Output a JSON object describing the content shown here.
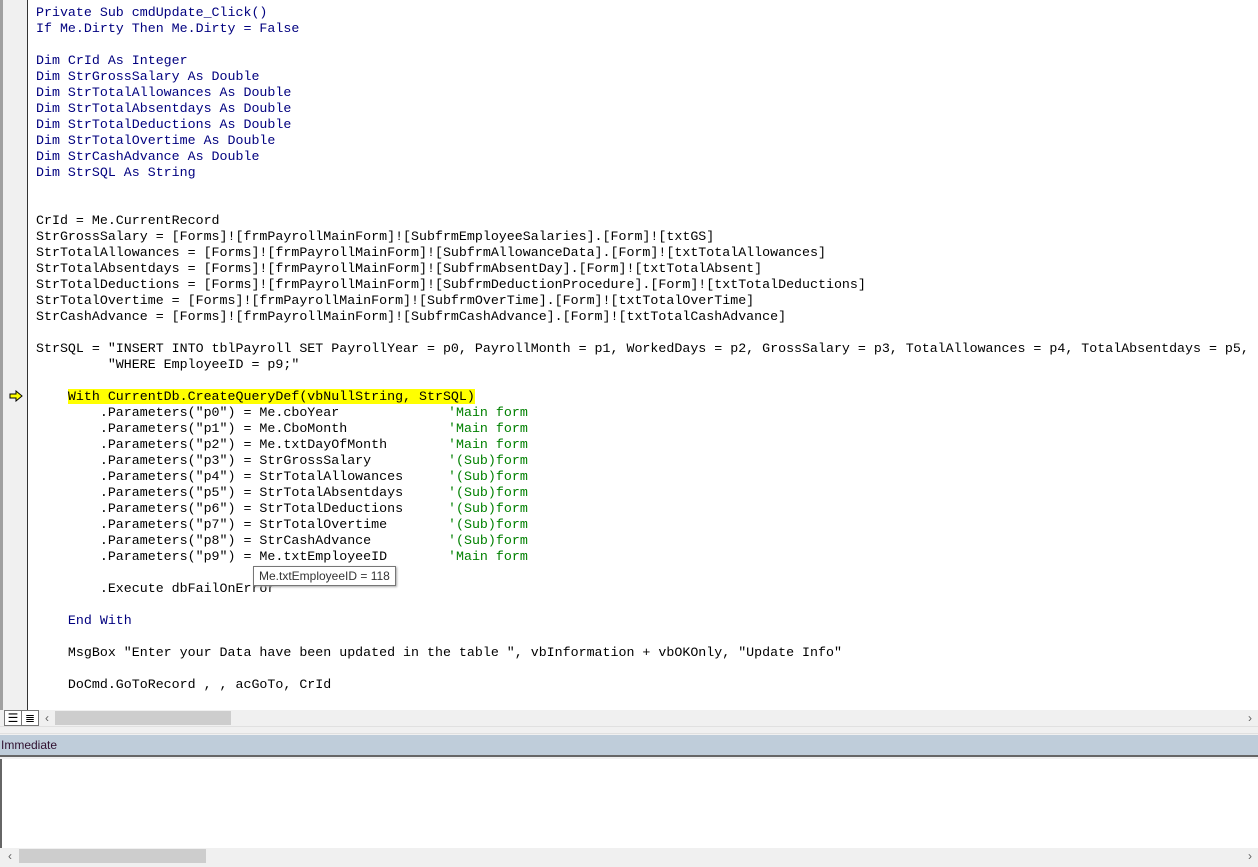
{
  "editor": {
    "lines": [
      [
        [
          "Private Sub cmdUpdate_Click()",
          "kw"
        ]
      ],
      [
        [
          "If Me.Dirty Then Me.Dirty = False",
          "kw"
        ]
      ],
      [],
      [
        [
          "Dim CrId As Integer",
          "kw"
        ]
      ],
      [
        [
          "Dim StrGrossSalary As Double",
          "kw"
        ]
      ],
      [
        [
          "Dim StrTotalAllowances As Double",
          "kw"
        ]
      ],
      [
        [
          "Dim StrTotalAbsentdays As Double",
          "kw"
        ]
      ],
      [
        [
          "Dim StrTotalDeductions As Double",
          "kw"
        ]
      ],
      [
        [
          "Dim StrTotalOvertime As Double",
          "kw"
        ]
      ],
      [
        [
          "Dim StrCashAdvance As Double",
          "kw"
        ]
      ],
      [
        [
          "Dim StrSQL As String",
          "kw"
        ]
      ],
      [],
      [],
      [
        [
          "CrId = Me.CurrentRecord",
          ""
        ]
      ],
      [
        [
          "StrGrossSalary = [Forms]![frmPayrollMainForm]![SubfrmEmployeeSalaries].[Form]![txtGS]",
          ""
        ]
      ],
      [
        [
          "StrTotalAllowances = [Forms]![frmPayrollMainForm]![SubfrmAllowanceData].[Form]![txtTotalAllowances]",
          ""
        ]
      ],
      [
        [
          "StrTotalAbsentdays = [Forms]![frmPayrollMainForm]![SubfrmAbsentDay].[Form]![txtTotalAbsent]",
          ""
        ]
      ],
      [
        [
          "StrTotalDeductions = [Forms]![frmPayrollMainForm]![SubfrmDeductionProcedure].[Form]![txtTotalDeductions]",
          ""
        ]
      ],
      [
        [
          "StrTotalOvertime = [Forms]![frmPayrollMainForm]![SubfrmOverTime].[Form]![txtTotalOverTime]",
          ""
        ]
      ],
      [
        [
          "StrCashAdvance = [Forms]![frmPayrollMainForm]![SubfrmCashAdvance].[Form]![txtTotalCashAdvance]",
          ""
        ]
      ],
      [],
      [
        [
          "StrSQL = \"INSERT INTO tblPayroll SET PayrollYear = p0, PayrollMonth = p1, WorkedDays = p2, GrossSalary = p3, TotalAllowances = p4, TotalAbsentdays = p5,",
          ""
        ]
      ],
      [
        [
          "         \"WHERE EmployeeID = p9;\"",
          ""
        ]
      ],
      [],
      [
        [
          "    ",
          ""
        ],
        [
          "With CurrentDb.CreateQueryDef(vbNullString, StrSQL)",
          "hl"
        ]
      ],
      [
        [
          "        .Parameters(\"p0\") = Me.cboYear",
          ""
        ],
        [
          "'Main form",
          "cmt"
        ]
      ],
      [
        [
          "        .Parameters(\"p1\") = Me.CboMonth",
          ""
        ],
        [
          "'Main form",
          "cmt"
        ]
      ],
      [
        [
          "        .Parameters(\"p2\") = Me.txtDayOfMonth",
          ""
        ],
        [
          "'Main form",
          "cmt"
        ]
      ],
      [
        [
          "        .Parameters(\"p3\") = StrGrossSalary",
          ""
        ],
        [
          "'(Sub)form",
          "cmt"
        ]
      ],
      [
        [
          "        .Parameters(\"p4\") = StrTotalAllowances",
          ""
        ],
        [
          "'(Sub)form",
          "cmt"
        ]
      ],
      [
        [
          "        .Parameters(\"p5\") = StrTotalAbsentdays",
          ""
        ],
        [
          "'(Sub)form",
          "cmt"
        ]
      ],
      [
        [
          "        .Parameters(\"p6\") = StrTotalDeductions",
          ""
        ],
        [
          "'(Sub)form",
          "cmt"
        ]
      ],
      [
        [
          "        .Parameters(\"p7\") = StrTotalOvertime",
          ""
        ],
        [
          "'(Sub)form",
          "cmt"
        ]
      ],
      [
        [
          "        .Parameters(\"p8\") = StrCashAdvance",
          ""
        ],
        [
          "'(Sub)form",
          "cmt"
        ]
      ],
      [
        [
          "        .Parameters(\"p9\") = Me.txtEmployeeID",
          ""
        ],
        [
          "'Main form",
          "cmt"
        ]
      ],
      [],
      [
        [
          "        .Execute dbFailOnError",
          ""
        ]
      ],
      [],
      [
        [
          "    End With",
          "kw"
        ]
      ],
      [],
      [
        [
          "    MsgBox \"Enter your Data have been updated in the table \", vbInformation + vbOKOnly, \"Update Info\"",
          ""
        ]
      ],
      [],
      [
        [
          "    DoCmd.GoToRecord , , acGoTo, CrId",
          ""
        ]
      ]
    ],
    "tooltip": "Me.txtEmployeeID = 118"
  },
  "immediate": {
    "title": "Immediate"
  }
}
